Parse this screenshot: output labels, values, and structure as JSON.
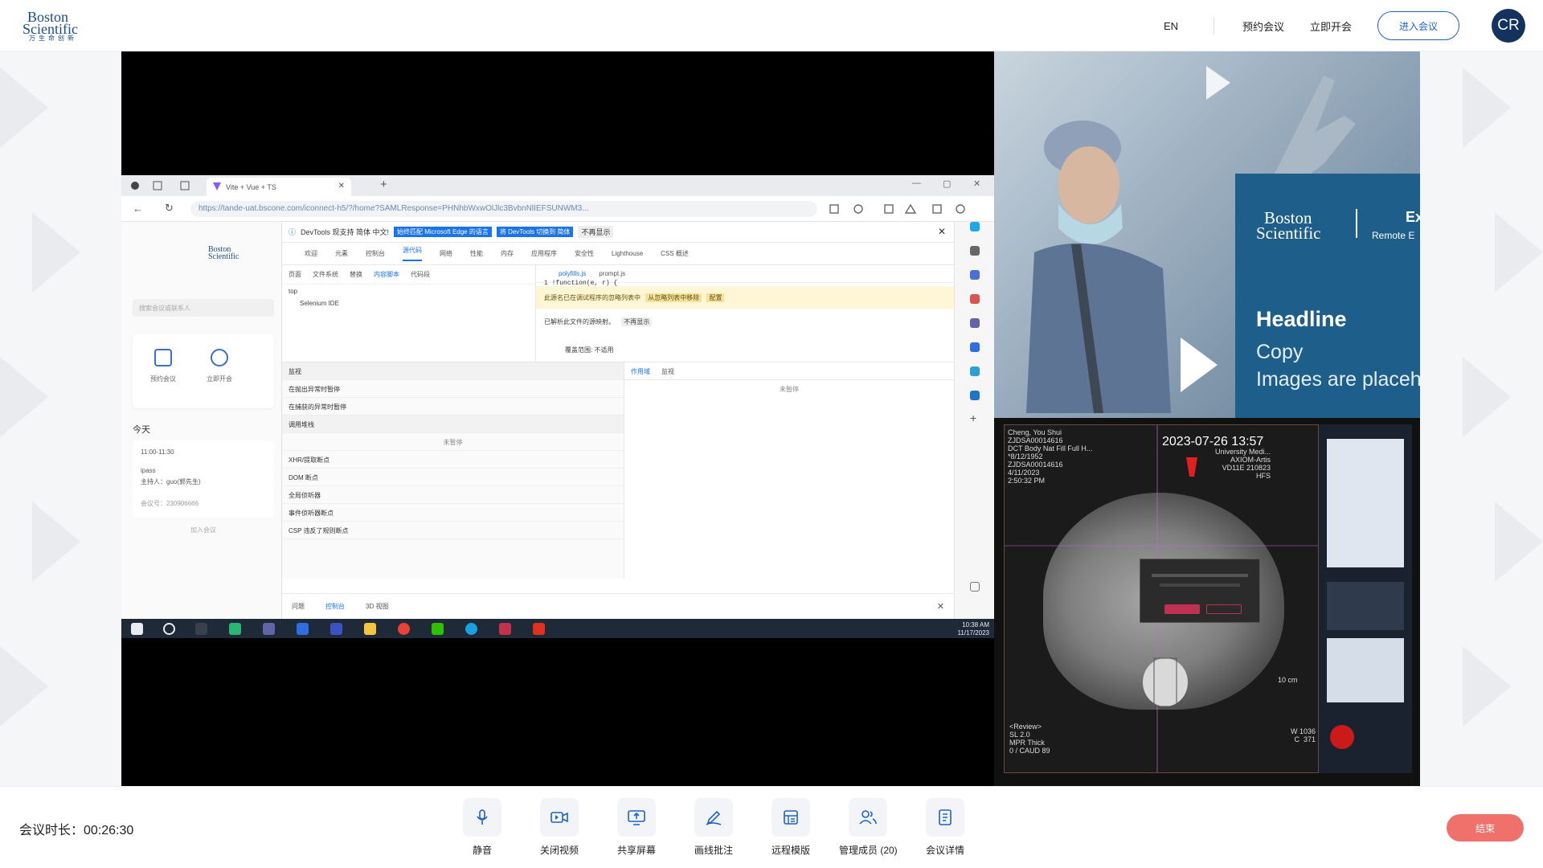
{
  "header": {
    "logo": {
      "line1": "Boston",
      "line2": "Scientific",
      "line3": "万生命创新"
    },
    "lang": "EN",
    "book_meeting": "预约会议",
    "start_now": "立即开会",
    "join_meeting": "进入会议",
    "avatar_initials": "CR"
  },
  "shared_screen": {
    "browser_tab_title": "Vite + Vue + TS",
    "url": "https://tande-uat.bscone.com/iconnect-h5/?/home?SAMLResponse=PHNhbWxwOlJlc3BvbnNlIEFSUNWM3...",
    "app": {
      "search_placeholder": "搜索会议或联系人",
      "tile1": "预约会议",
      "tile2": "立即开会",
      "today": "今天",
      "meeting_time": "11:00-11:30",
      "meeting_title": "ipass",
      "meeting_host": "主持人：guo(郭先生)",
      "meeting_id": "会议号：230906666",
      "more": "加入会议"
    },
    "devtools": {
      "info_text": "DevTools 现支持 简体 中文!",
      "info_btn1": "始终匹配 Microsoft Edge 的语言",
      "info_btn2": "将 DevTools 切换到 简体",
      "info_btn3": "不再显示",
      "tabs": [
        "欢迎",
        "元素",
        "控制台",
        "源代码",
        "网络",
        "性能",
        "内存",
        "应用程序",
        "安全性",
        "Lighthouse",
        "CSS 概述"
      ],
      "active_tab": "源代码",
      "source_tabs": [
        "页面",
        "文件系统",
        "替换",
        "内容脚本",
        "代码段"
      ],
      "file_top": "top",
      "file_child": "Selenium IDE",
      "editor_files": [
        "polyfills.js",
        "prompt.js"
      ],
      "editor_code": "1   !function(e, r) {",
      "warning": "此源名已在调试程序的忽略列表中",
      "warning_btn1": "从忽略列表中移除",
      "warning_btn2": "配置",
      "note": "已解析此文件的源映射。",
      "note_btn": "不再显示",
      "coverage": "覆盖范围: 不适用",
      "debug_sections": [
        "监视",
        "在抛出异常时暂停",
        "在捕获的异常时暂停",
        "调用堆栈",
        "XHR/提取断点",
        "DOM 断点",
        "全局侦听器",
        "事件侦听器断点",
        "CSP 违反了规则断点"
      ],
      "not_paused": "未暂停",
      "scope_tabs": [
        "作用域",
        "监视"
      ],
      "scope_empty": "未暂停",
      "drawer_tabs": [
        "问题",
        "控制台",
        "3D 视图"
      ]
    },
    "taskbar_clock": {
      "time": "10:38 AM",
      "date": "11/17/2023"
    }
  },
  "side_top": {
    "brand_line1": "Boston",
    "brand_line2": "Scientific",
    "brand_ex": "Ex",
    "remote": "Remote E",
    "headline": "Headline",
    "copy": "Copy",
    "images": "Images are placeh"
  },
  "side_bottom": {
    "patient_meta": "Cheng, You Shui\nZJDSA00014616\nDCT Body Nat Fill Full H...\n*8/12/1952\nZJDSA00014616\n4/11/2023\n2:50:32 PM",
    "scan_time": "2023-07-26 13:57",
    "device": "University Medi...\nAXIOM-Artis\nVD11E 210823\nHFS",
    "review": "<Review>\nSL 2.0\nMPR Thick\n0 / CAUD 89",
    "scale": "10 cm",
    "wl": "W 1036\nC  371"
  },
  "bottom_bar": {
    "duration_label": "会议时长：",
    "duration": "00:26:30",
    "controls": [
      {
        "label": "静音",
        "icon": "mic-icon"
      },
      {
        "label": "关闭视频",
        "icon": "video-icon"
      },
      {
        "label": "共享屏幕",
        "icon": "share-screen-icon"
      },
      {
        "label": "画线批注",
        "icon": "annotate-icon"
      },
      {
        "label": "远程模版",
        "icon": "remote-template-icon"
      },
      {
        "label": "管理成员 (20)",
        "icon": "members-icon"
      },
      {
        "label": "会议详情",
        "icon": "meeting-details-icon"
      }
    ],
    "end": "结束"
  },
  "colors": {
    "brand_blue": "#1e62c8",
    "avatar_bg": "#13325e",
    "end_red": "#f0706b",
    "bsci_panel": "#1d5f8a"
  }
}
